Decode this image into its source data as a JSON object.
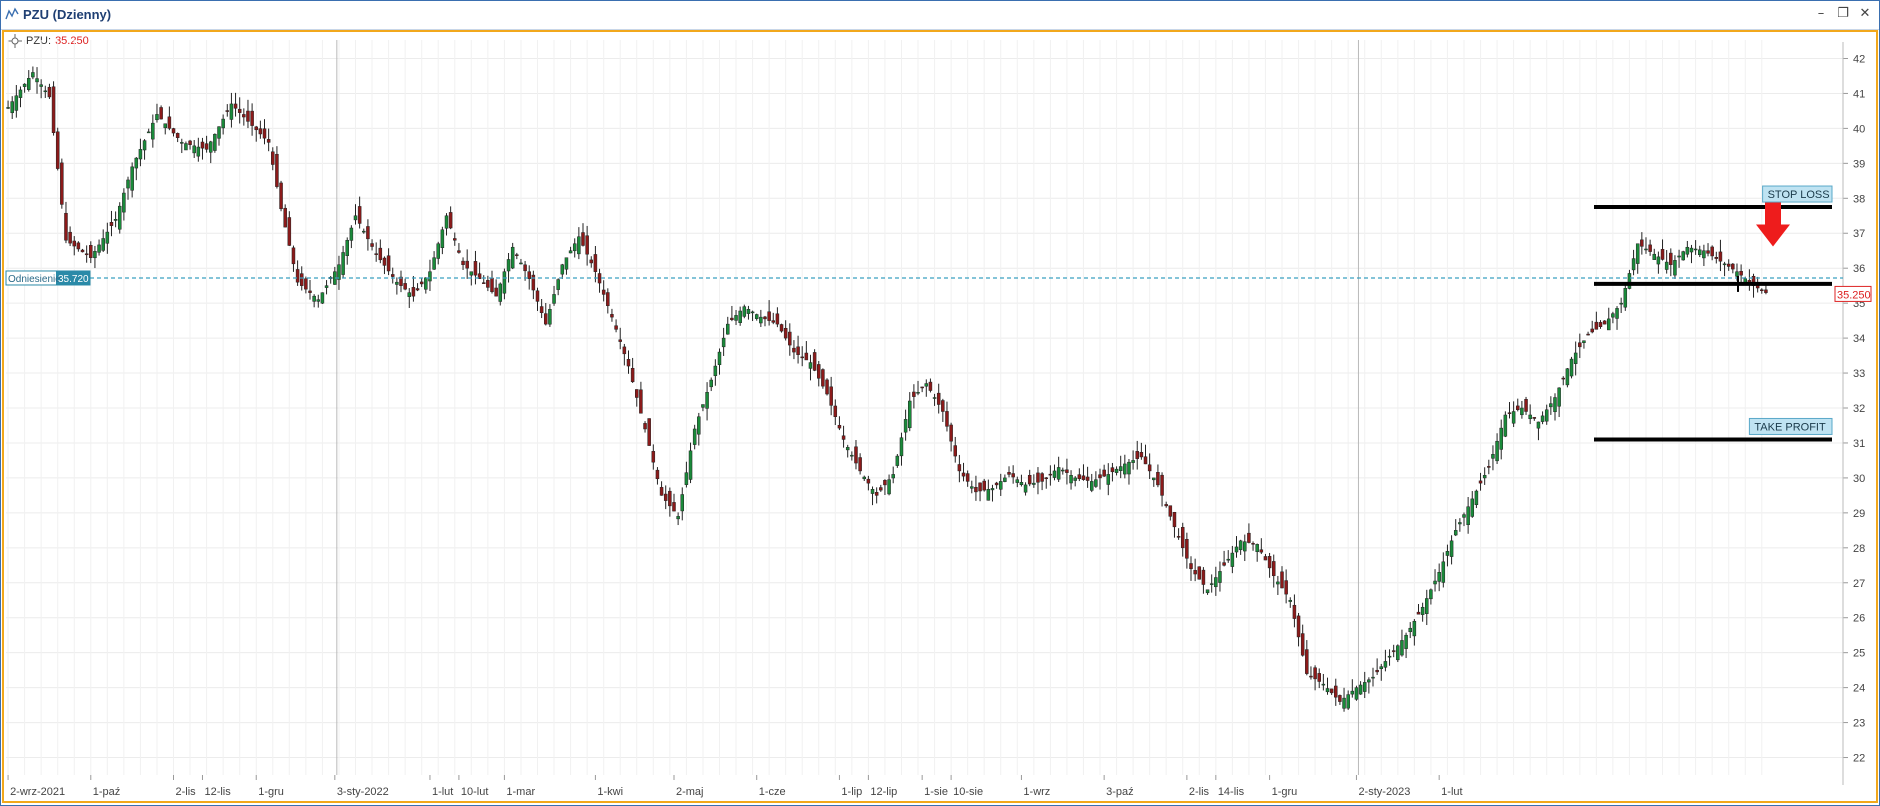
{
  "window": {
    "title": "PZU (Dzienny)",
    "title_icon": "line-chart-icon"
  },
  "legend": {
    "symbol": "PZU:",
    "price": "35.250"
  },
  "chart_data": {
    "type": "candlestick",
    "title": "",
    "xlabel": "",
    "ylabel": "",
    "ylim": [
      21.5,
      42.3
    ],
    "y_ticks": [
      22,
      23,
      24,
      25,
      26,
      27,
      28,
      29,
      30,
      31,
      32,
      33,
      34,
      35,
      36,
      37,
      38,
      39,
      40,
      41,
      42
    ],
    "x_tick_labels": [
      "2-wrz-2021",
      "1-paź",
      "2-lis",
      "12-lis",
      "1-gru",
      "3-sty-2022",
      "1-lut",
      "10-lut",
      "1-mar",
      "1-kwi",
      "2-maj",
      "1-cze",
      "1-lip",
      "12-lip",
      "1-sie",
      "10-sie",
      "1-wrz",
      "3-paź",
      "2-lis",
      "14-lis",
      "1-gru",
      "2-sty-2023",
      "1-lut"
    ],
    "grid": true,
    "reference_line": {
      "label": "Odniesienie",
      "value": 35.72
    },
    "last_price": {
      "label": "35.250",
      "value": 35.25
    },
    "levels": [
      {
        "label": "STOP LOSS",
        "value": 37.75
      },
      {
        "label": "",
        "value": 35.55
      },
      {
        "label": "TAKE PROFIT",
        "value": 31.1
      }
    ],
    "signal": {
      "type": "sell-arrow",
      "color": "#ee1c1c"
    },
    "colors": {
      "up": "#1a8a3a",
      "down": "#8b1a1a",
      "wick": "#222222",
      "reference": "#3aa0c0",
      "levels": "#000000"
    },
    "close_path": [
      [
        0,
        40.6
      ],
      [
        6,
        41.6
      ],
      [
        10,
        40.9
      ],
      [
        14,
        36.8
      ],
      [
        20,
        36.3
      ],
      [
        26,
        37.4
      ],
      [
        30,
        38.9
      ],
      [
        36,
        40.4
      ],
      [
        42,
        39.6
      ],
      [
        48,
        39.4
      ],
      [
        54,
        40.7
      ],
      [
        58,
        40.2
      ],
      [
        63,
        39.6
      ],
      [
        66,
        37.7
      ],
      [
        70,
        35.6
      ],
      [
        75,
        35.1
      ],
      [
        80,
        36.1
      ],
      [
        84,
        37.5
      ],
      [
        89,
        36.4
      ],
      [
        94,
        35.6
      ],
      [
        98,
        35.2
      ],
      [
        102,
        35.9
      ],
      [
        106,
        37.5
      ],
      [
        110,
        36.1
      ],
      [
        114,
        35.7
      ],
      [
        118,
        35.2
      ],
      [
        122,
        36.6
      ],
      [
        126,
        35.7
      ],
      [
        130,
        34.4
      ],
      [
        134,
        36.1
      ],
      [
        138,
        36.9
      ],
      [
        142,
        35.9
      ],
      [
        146,
        34.6
      ],
      [
        150,
        33.2
      ],
      [
        154,
        31.4
      ],
      [
        158,
        29.5
      ],
      [
        162,
        28.9
      ],
      [
        166,
        31.4
      ],
      [
        170,
        32.8
      ],
      [
        174,
        34.4
      ],
      [
        178,
        34.9
      ],
      [
        182,
        34.6
      ],
      [
        186,
        34.4
      ],
      [
        190,
        33.6
      ],
      [
        194,
        33.3
      ],
      [
        198,
        32.4
      ],
      [
        202,
        31.1
      ],
      [
        206,
        30.2
      ],
      [
        210,
        29.5
      ],
      [
        214,
        30.1
      ],
      [
        218,
        32.2
      ],
      [
        222,
        32.7
      ],
      [
        226,
        31.9
      ],
      [
        230,
        30.2
      ],
      [
        234,
        29.6
      ],
      [
        238,
        29.7
      ],
      [
        242,
        30.1
      ],
      [
        246,
        29.8
      ],
      [
        250,
        29.9
      ],
      [
        254,
        30.3
      ],
      [
        258,
        30.0
      ],
      [
        262,
        29.9
      ],
      [
        266,
        30.1
      ],
      [
        270,
        30.4
      ],
      [
        274,
        30.6
      ],
      [
        278,
        29.8
      ],
      [
        282,
        28.6
      ],
      [
        286,
        27.4
      ],
      [
        290,
        26.8
      ],
      [
        294,
        27.5
      ],
      [
        298,
        28.2
      ],
      [
        302,
        28.1
      ],
      [
        306,
        27.2
      ],
      [
        310,
        26.5
      ],
      [
        314,
        24.4
      ],
      [
        318,
        24.1
      ],
      [
        322,
        23.6
      ],
      [
        326,
        24.0
      ],
      [
        330,
        24.3
      ],
      [
        334,
        24.9
      ],
      [
        338,
        25.5
      ],
      [
        342,
        26.3
      ],
      [
        346,
        27.3
      ],
      [
        350,
        28.5
      ],
      [
        354,
        29.4
      ],
      [
        358,
        30.3
      ],
      [
        362,
        31.8
      ],
      [
        366,
        32.0
      ],
      [
        370,
        31.6
      ],
      [
        374,
        32.3
      ],
      [
        378,
        33.4
      ],
      [
        382,
        34.1
      ],
      [
        386,
        34.4
      ],
      [
        390,
        35.0
      ],
      [
        394,
        36.7
      ],
      [
        398,
        36.4
      ],
      [
        402,
        36.1
      ],
      [
        406,
        36.6
      ],
      [
        410,
        36.5
      ],
      [
        414,
        36.2
      ],
      [
        418,
        35.9
      ],
      [
        422,
        35.5
      ],
      [
        425,
        35.3
      ]
    ]
  }
}
